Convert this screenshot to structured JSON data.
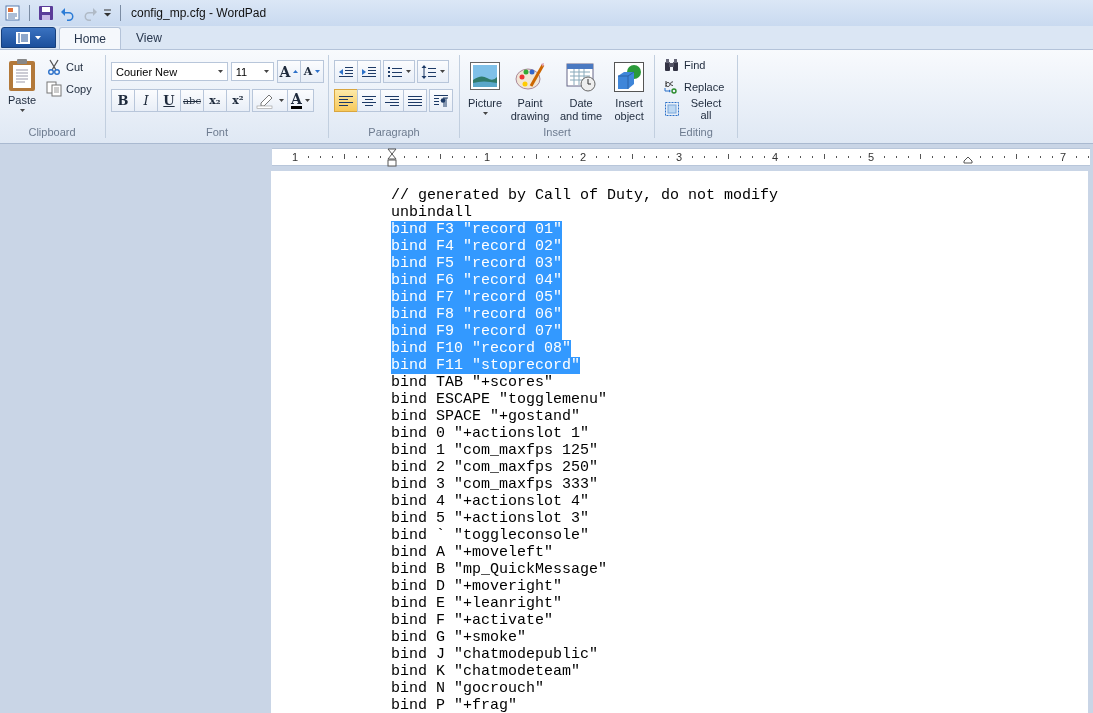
{
  "window": {
    "title": "config_mp.cfg - WordPad"
  },
  "tabs": [
    {
      "label": "Home",
      "selected": true
    },
    {
      "label": "View",
      "selected": false
    }
  ],
  "clipboard": {
    "label": "Clipboard",
    "paste": "Paste",
    "cut": "Cut",
    "copy": "Copy"
  },
  "font": {
    "label": "Font",
    "font_name": "Courier New",
    "font_size": "11",
    "grow_glyph": "A",
    "shrink_glyph": "A",
    "color_glyph": "A",
    "format_buttons": [
      {
        "kind": "bold",
        "glyph": "B"
      },
      {
        "kind": "italic",
        "glyph": "I"
      },
      {
        "kind": "underline",
        "glyph": "U"
      },
      {
        "kind": "strike",
        "glyph": "abc"
      },
      {
        "kind": "sub",
        "glyph": "x₂"
      },
      {
        "kind": "sup",
        "glyph": "x²"
      }
    ]
  },
  "paragraph": {
    "label": "Paragraph",
    "align_buttons": [
      {
        "kind": "left",
        "selected": true
      },
      {
        "kind": "center",
        "selected": false
      },
      {
        "kind": "right",
        "selected": false
      },
      {
        "kind": "justify",
        "selected": false
      }
    ]
  },
  "insert": {
    "label": "Insert",
    "buttons": [
      {
        "kind": "picture",
        "label": "Picture"
      },
      {
        "kind": "paint",
        "label": "Paint drawing"
      },
      {
        "kind": "datetime",
        "label": "Date and time"
      },
      {
        "kind": "object",
        "label": "Insert object"
      }
    ]
  },
  "editing": {
    "label": "Editing",
    "buttons": [
      {
        "kind": "find",
        "label": "Find"
      },
      {
        "kind": "replace",
        "label": "Replace"
      },
      {
        "kind": "selectall",
        "label": "Select all"
      }
    ]
  },
  "ruler": {
    "labels": [
      "1",
      "1",
      "2",
      "3",
      "4",
      "5",
      "7"
    ]
  },
  "document": {
    "lines": [
      {
        "text": "// generated by Call of Duty, do not modify",
        "selected": false
      },
      {
        "text": "unbindall",
        "selected": false
      },
      {
        "text": "bind F3 \"record 01\"",
        "selected": true
      },
      {
        "text": "bind F4 \"record 02\"",
        "selected": true
      },
      {
        "text": "bind F5 \"record 03\"",
        "selected": true
      },
      {
        "text": "bind F6 \"record 04\"",
        "selected": true
      },
      {
        "text": "bind F7 \"record 05\"",
        "selected": true
      },
      {
        "text": "bind F8 \"record 06\"",
        "selected": true
      },
      {
        "text": "bind F9 \"record 07\"",
        "selected": true
      },
      {
        "text": "bind F10 \"record 08\"",
        "selected": true
      },
      {
        "text": "bind F11 \"stoprecord\"",
        "selected": true
      },
      {
        "text": "bind TAB \"+scores\"",
        "selected": false
      },
      {
        "text": "bind ESCAPE \"togglemenu\"",
        "selected": false
      },
      {
        "text": "bind SPACE \"+gostand\"",
        "selected": false
      },
      {
        "text": "bind 0 \"+actionslot 1\"",
        "selected": false
      },
      {
        "text": "bind 1 \"com_maxfps 125\"",
        "selected": false
      },
      {
        "text": "bind 2 \"com_maxfps 250\"",
        "selected": false
      },
      {
        "text": "bind 3 \"com_maxfps 333\"",
        "selected": false
      },
      {
        "text": "bind 4 \"+actionslot 4\"",
        "selected": false
      },
      {
        "text": "bind 5 \"+actionslot 3\"",
        "selected": false
      },
      {
        "text": "bind ` \"toggleconsole\"",
        "selected": false
      },
      {
        "text": "bind A \"+moveleft\"",
        "selected": false
      },
      {
        "text": "bind B \"mp_QuickMessage\"",
        "selected": false
      },
      {
        "text": "bind D \"+moveright\"",
        "selected": false
      },
      {
        "text": "bind E \"+leanright\"",
        "selected": false
      },
      {
        "text": "bind F \"+activate\"",
        "selected": false
      },
      {
        "text": "bind G \"+smoke\"",
        "selected": false
      },
      {
        "text": "bind J \"chatmodepublic\"",
        "selected": false
      },
      {
        "text": "bind K \"chatmodeteam\"",
        "selected": false
      },
      {
        "text": "bind N \"gocrouch\"",
        "selected": false
      },
      {
        "text": "bind P \"+frag\"",
        "selected": false
      }
    ]
  }
}
